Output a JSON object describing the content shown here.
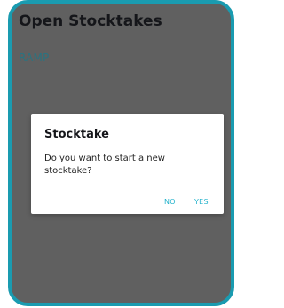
{
  "screen": {
    "title": "Open Stocktakes",
    "items": [
      {
        "label": "RAMP"
      }
    ]
  },
  "dialog": {
    "title": "Stocktake",
    "message": "Do you want to start a new stocktake?",
    "no_label": "NO",
    "yes_label": "YES"
  },
  "colors": {
    "frame": "#1a9bb0",
    "scrim": "#606060",
    "accent": "#24b3cc"
  }
}
